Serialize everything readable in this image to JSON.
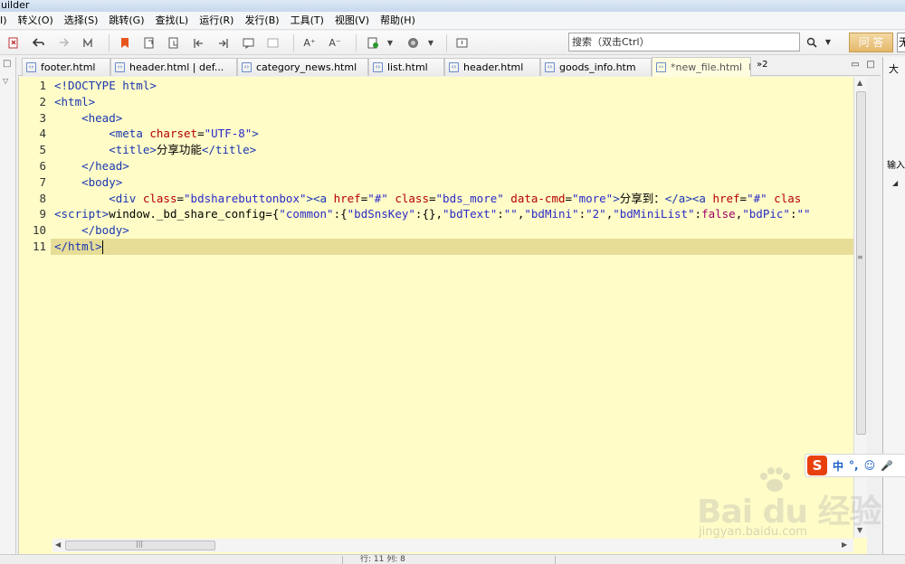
{
  "window": {
    "title_fragment": "uilder"
  },
  "menu": [
    {
      "id": "convert",
      "label": "转义(O)"
    },
    {
      "id": "select",
      "label": "选择(S)"
    },
    {
      "id": "jump",
      "label": "跳转(G)"
    },
    {
      "id": "find",
      "label": "查找(L)"
    },
    {
      "id": "run",
      "label": "运行(R)"
    },
    {
      "id": "publish",
      "label": "发行(B)"
    },
    {
      "id": "tools",
      "label": "工具(T)"
    },
    {
      "id": "view",
      "label": "视图(V)"
    },
    {
      "id": "help",
      "label": "帮助(H)"
    }
  ],
  "menu_fragment": "I)",
  "toolbar": {
    "search_placeholder": "搜索（双击Ctrl）",
    "ask_label": "问 答",
    "edge_label": "无",
    "font_increase": "A⁺",
    "font_decrease": "A⁻"
  },
  "tabs": [
    {
      "label": "footer.html",
      "active": false
    },
    {
      "label": "header.html | def...",
      "active": false
    },
    {
      "label": "category_news.html",
      "active": false
    },
    {
      "label": "list.html",
      "active": false
    },
    {
      "label": "header.html",
      "active": false
    },
    {
      "label": "goods_info.htm",
      "active": false
    },
    {
      "label": "*new_file.html",
      "active": true
    }
  ],
  "overflow_tabs": "»2",
  "editor": {
    "line_numbers": [
      "1",
      "2",
      "3",
      "4",
      "5",
      "6",
      "7",
      "8",
      "9",
      "10",
      "11"
    ],
    "current_line": 11,
    "lines": [
      [
        {
          "t": "<!DOCTYPE html>",
          "c": "c-decl"
        }
      ],
      [
        {
          "t": "<html>",
          "c": "c-tag"
        }
      ],
      [
        {
          "t": "    "
        },
        {
          "t": "<head>",
          "c": "c-tag"
        }
      ],
      [
        {
          "t": "        "
        },
        {
          "t": "<meta ",
          "c": "c-tag"
        },
        {
          "t": "charset",
          "c": "c-attr"
        },
        {
          "t": "=",
          "c": "c-text"
        },
        {
          "t": "\"UTF-8\"",
          "c": "c-val"
        },
        {
          "t": ">",
          "c": "c-tag"
        }
      ],
      [
        {
          "t": "        "
        },
        {
          "t": "<title>",
          "c": "c-tag"
        },
        {
          "t": "分享功能",
          "c": "c-text"
        },
        {
          "t": "</title>",
          "c": "c-tag"
        }
      ],
      [
        {
          "t": "    "
        },
        {
          "t": "</head>",
          "c": "c-tag"
        }
      ],
      [
        {
          "t": "    "
        },
        {
          "t": "<body>",
          "c": "c-tag"
        }
      ],
      [
        {
          "t": "        "
        },
        {
          "t": "<div ",
          "c": "c-tag"
        },
        {
          "t": "class",
          "c": "c-attr"
        },
        {
          "t": "=",
          "c": "c-text"
        },
        {
          "t": "\"bdsharebuttonbox\"",
          "c": "c-val"
        },
        {
          "t": "><a ",
          "c": "c-tag"
        },
        {
          "t": "href",
          "c": "c-attr"
        },
        {
          "t": "=",
          "c": "c-text"
        },
        {
          "t": "\"#\"",
          "c": "c-val"
        },
        {
          "t": " class",
          "c": "c-attr"
        },
        {
          "t": "=",
          "c": "c-text"
        },
        {
          "t": "\"bds_more\"",
          "c": "c-val"
        },
        {
          "t": " data-cmd",
          "c": "c-attr"
        },
        {
          "t": "=",
          "c": "c-text"
        },
        {
          "t": "\"more\"",
          "c": "c-val"
        },
        {
          "t": ">",
          "c": "c-tag"
        },
        {
          "t": "分享到：",
          "c": "c-text"
        },
        {
          "t": "</a><a ",
          "c": "c-tag"
        },
        {
          "t": "href",
          "c": "c-attr"
        },
        {
          "t": "=",
          "c": "c-text"
        },
        {
          "t": "\"#\"",
          "c": "c-val"
        },
        {
          "t": " clas",
          "c": "c-attr"
        }
      ],
      [
        {
          "t": "<script>",
          "c": "c-tag"
        },
        {
          "t": "window._bd_share_config={",
          "c": "c-text"
        },
        {
          "t": "\"common\"",
          "c": "c-val"
        },
        {
          "t": ":{",
          "c": "c-text"
        },
        {
          "t": "\"bdSnsKey\"",
          "c": "c-val"
        },
        {
          "t": ":{},",
          "c": "c-text"
        },
        {
          "t": "\"bdText\"",
          "c": "c-val"
        },
        {
          "t": ":",
          "c": "c-text"
        },
        {
          "t": "\"\"",
          "c": "c-val"
        },
        {
          "t": ",",
          "c": "c-text"
        },
        {
          "t": "\"bdMini\"",
          "c": "c-val"
        },
        {
          "t": ":",
          "c": "c-text"
        },
        {
          "t": "\"2\"",
          "c": "c-val"
        },
        {
          "t": ",",
          "c": "c-text"
        },
        {
          "t": "\"bdMiniList\"",
          "c": "c-val"
        },
        {
          "t": ":",
          "c": "c-text"
        },
        {
          "t": "false",
          "c": "c-kw"
        },
        {
          "t": ",",
          "c": "c-text"
        },
        {
          "t": "\"bdPic\"",
          "c": "c-val"
        },
        {
          "t": ":",
          "c": "c-text"
        },
        {
          "t": "\"\"",
          "c": "c-val"
        }
      ],
      [
        {
          "t": "    "
        },
        {
          "t": "</body>",
          "c": "c-tag"
        }
      ],
      [
        {
          "t": "</html>",
          "c": "c-tag"
        }
      ]
    ]
  },
  "right_panel": {
    "title": "大",
    "input_label": "输入"
  },
  "ime": {
    "logo": "S",
    "mode": "中",
    "punct": "°,",
    "emoji": "☺",
    "mic": "🎤"
  },
  "status": {
    "text": "行: 11 列: 8"
  },
  "watermark": {
    "brand": "Bai du 经验",
    "url": "jingyan.baidu.com"
  },
  "colors": {
    "editor_bg": "#fffcc8",
    "current_line": "#e7dd97",
    "tag": "#1a36b0",
    "attr": "#b60000",
    "value": "#2a2ac8"
  }
}
